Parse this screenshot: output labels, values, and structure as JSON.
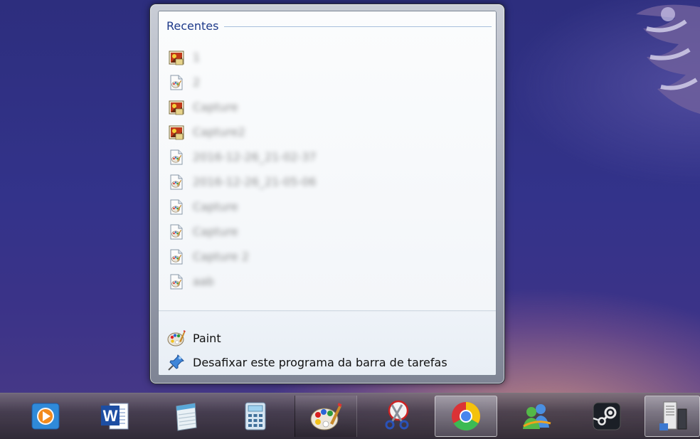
{
  "jumplist": {
    "section_title": "Recentes",
    "recent_items": [
      {
        "label": "1",
        "icon": "image-file-icon"
      },
      {
        "label": "2",
        "icon": "paint-file-icon"
      },
      {
        "label": "Capture",
        "icon": "image-file-icon"
      },
      {
        "label": "Capture2",
        "icon": "image-file-icon"
      },
      {
        "label": "2016-12-26_21-02-37",
        "icon": "paint-file-icon"
      },
      {
        "label": "2016-12-26_21-05-06",
        "icon": "paint-file-icon"
      },
      {
        "label": "Capture",
        "icon": "paint-file-icon"
      },
      {
        "label": "Capture",
        "icon": "paint-file-icon"
      },
      {
        "label": "Capture 2",
        "icon": "paint-file-icon"
      },
      {
        "label": "aab",
        "icon": "paint-file-icon"
      }
    ],
    "tasks": {
      "app_label": "Paint",
      "unpin_label": "Desafixar este programa da barra de tarefas"
    }
  },
  "taskbar": {
    "items": [
      {
        "name": "windows-media-player",
        "icon": "media-player-icon",
        "state": "pinned"
      },
      {
        "name": "microsoft-word",
        "icon": "word-icon",
        "state": "pinned"
      },
      {
        "name": "notepad",
        "icon": "notepad-icon",
        "state": "pinned"
      },
      {
        "name": "calculator",
        "icon": "calculator-icon",
        "state": "pinned"
      },
      {
        "name": "paint",
        "icon": "paint-icon",
        "state": "open"
      },
      {
        "name": "snipping-tool",
        "icon": "scissors-icon",
        "state": "pinned"
      },
      {
        "name": "google-chrome",
        "icon": "chrome-icon",
        "state": "active"
      },
      {
        "name": "windows-live-messenger",
        "icon": "messenger-icon",
        "state": "pinned"
      },
      {
        "name": "steam",
        "icon": "steam-icon",
        "state": "pinned"
      },
      {
        "name": "task-manager",
        "icon": "server-icon",
        "state": "active"
      }
    ]
  },
  "colors": {
    "section_title": "#1e3a8a",
    "desktop_top": "#2d2e7e",
    "taskbar": "#3a3240"
  }
}
